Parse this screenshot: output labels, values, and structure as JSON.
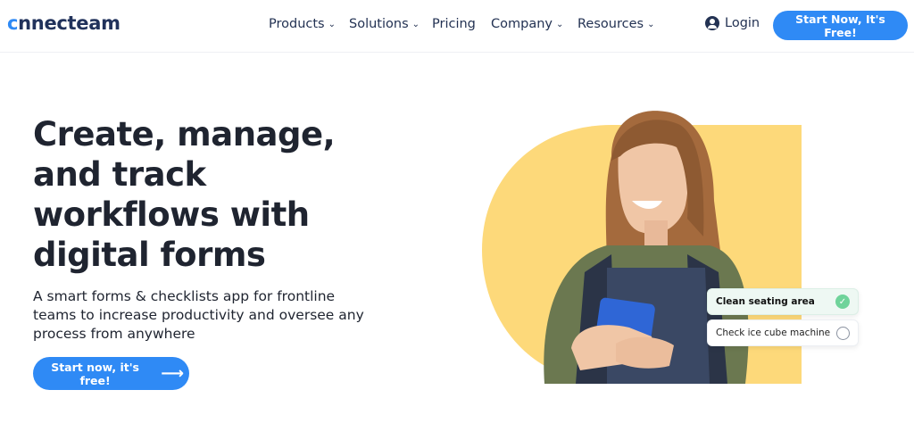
{
  "header": {
    "logo_text_c": "c",
    "logo_text_rest": "nnecteam",
    "nav": [
      {
        "label": "Products",
        "dropdown": true
      },
      {
        "label": "Solutions",
        "dropdown": true
      },
      {
        "label": "Pricing",
        "dropdown": false
      },
      {
        "label": "Company",
        "dropdown": true
      },
      {
        "label": "Resources",
        "dropdown": true
      }
    ],
    "login_label": "Login",
    "cta_label": "Start Now, It's Free!"
  },
  "hero": {
    "title_lines": [
      "Create, manage,",
      "and track",
      "workflows with",
      "digital forms"
    ],
    "subtitle": "A smart forms & checklists app for frontline teams to increase productivity and oversee any process from anywhere",
    "cta_label": "Start now, it's free!",
    "cta_icon": "arrow-right-icon"
  },
  "checklist": [
    {
      "label": "Clean seating area",
      "checked": true
    },
    {
      "label": "Check ice cube machine",
      "checked": false
    }
  ],
  "colors": {
    "accent": "#2f8af5",
    "navy": "#233253",
    "yellow_blob": "#fdd97a",
    "success": "#6fd39a"
  }
}
